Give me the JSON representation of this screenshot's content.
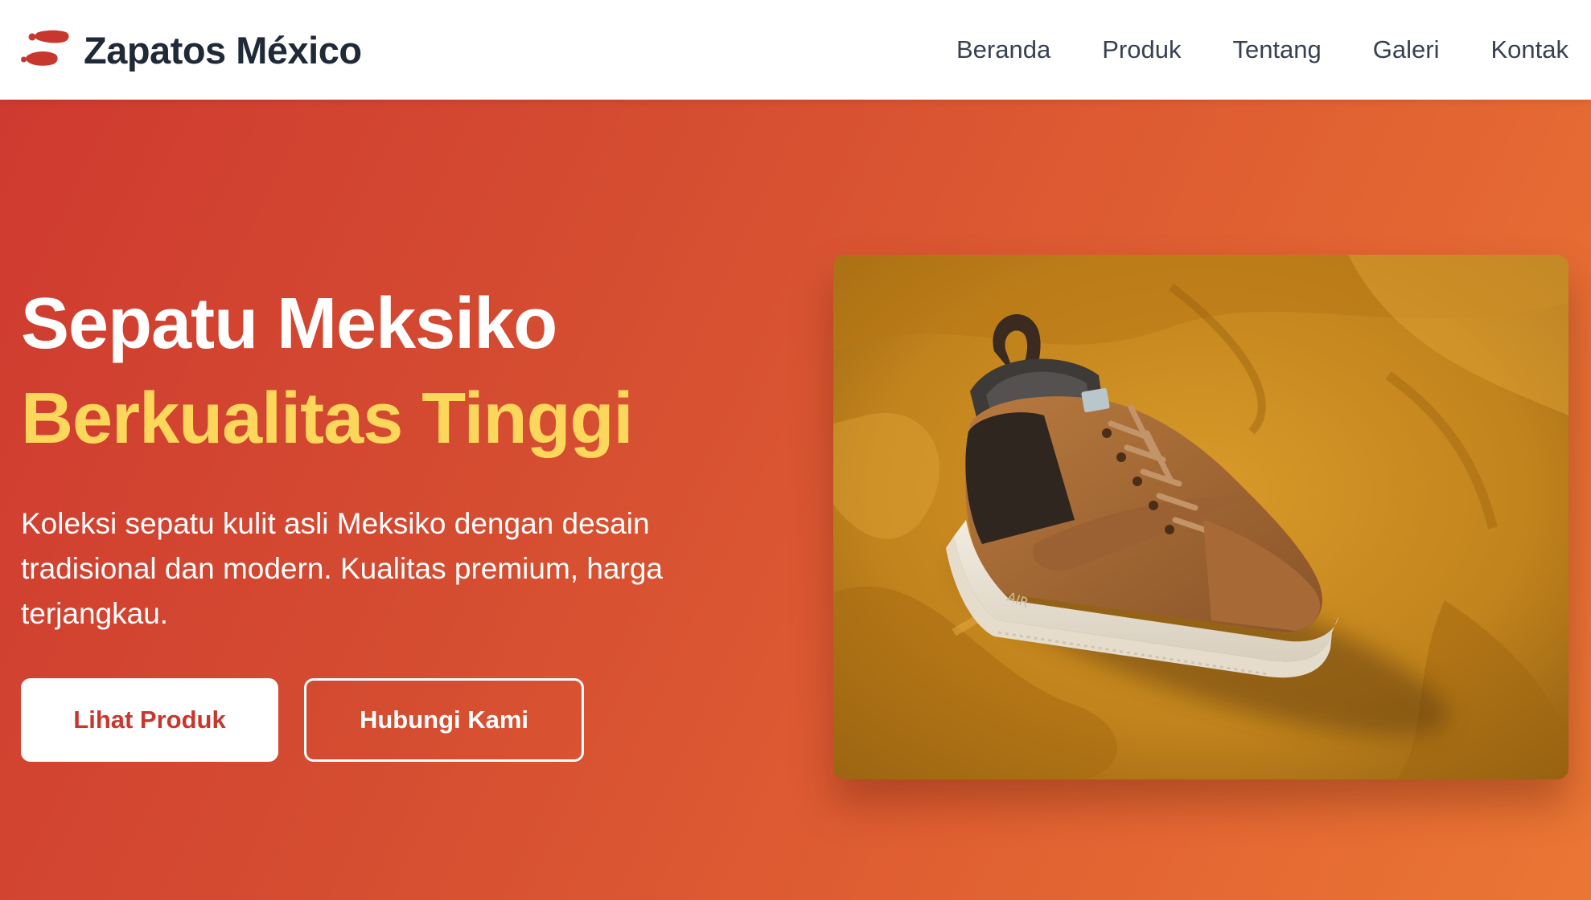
{
  "header": {
    "brand_name": "Zapatos México",
    "logo_icon": "footprints-icon",
    "nav": [
      {
        "label": "Beranda"
      },
      {
        "label": "Produk"
      },
      {
        "label": "Tentang"
      },
      {
        "label": "Galeri"
      },
      {
        "label": "Kontak"
      }
    ]
  },
  "hero": {
    "title_line_1": "Sepatu Meksiko",
    "title_line_2": "Berkualitas Tinggi",
    "description": "Koleksi sepatu kulit asli Meksiko dengan desain tradisional dan modern. Kualitas premium, harga terjangkau.",
    "primary_button": "Lihat Produk",
    "secondary_button": "Hubungi Kami",
    "image_subject": "brown sneaker on mustard corduroy fabric"
  },
  "colors": {
    "brand_red": "#c8372d",
    "gradient_start": "#cf3a30",
    "gradient_end": "#ea7634",
    "accent_yellow": "#fcd75b",
    "header_text": "#1f2937"
  }
}
